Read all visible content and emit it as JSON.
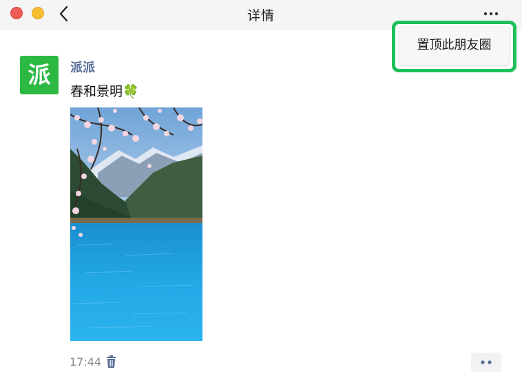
{
  "window": {
    "title": "详情"
  },
  "menu": {
    "pin_label": "置顶此朋友圈"
  },
  "post": {
    "avatar_text": "派",
    "author": "派派",
    "text": "春和景明🍀",
    "image_description_icon": "landscape-photo",
    "time": "17:44"
  },
  "icons": {
    "back": "chevron-left-icon",
    "more": "more-dots-icon",
    "delete": "trash-icon",
    "actions": "two-dots-icon"
  },
  "colors": {
    "titlebar_bg": "#f5f5f5",
    "highlight_border": "#1fc05a",
    "avatar_bg": "#2cb943",
    "author_name": "#576b95",
    "close_light": "#ee5c58",
    "minimize_light": "#f6be33"
  }
}
